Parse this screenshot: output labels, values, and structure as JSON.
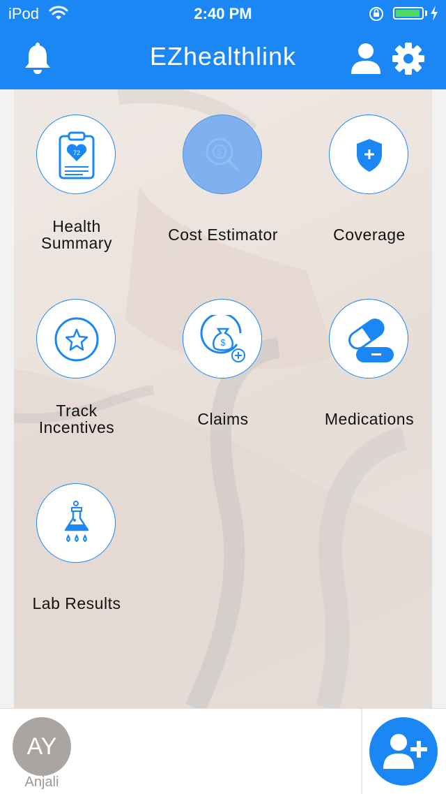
{
  "status_bar": {
    "carrier": "iPod",
    "time": "2:40 PM",
    "battery_fraction": 0.95,
    "icons": [
      "wifi-icon",
      "orientation-lock-icon",
      "battery-icon",
      "charging-bolt-icon"
    ]
  },
  "nav": {
    "title": "EZhealthlink",
    "icons": [
      "bell-icon",
      "user-icon",
      "gear-icon"
    ]
  },
  "colors": {
    "brand": "#1a87f5",
    "active_tile": "#7fb1f0",
    "avatar_bg": "#aba5a1",
    "battery": "#4cd964"
  },
  "tiles": [
    {
      "label": "Health Summary",
      "icon": "clipboard-heart-icon",
      "badge": "72"
    },
    {
      "label": "Cost Estimator",
      "icon": "cost-search-icon",
      "active": true
    },
    {
      "label": "Coverage",
      "icon": "shield-plus-icon"
    },
    {
      "label": "Track Incentives",
      "icon": "star-icon"
    },
    {
      "label": "Claims",
      "icon": "money-bag-icon"
    },
    {
      "label": "Medications",
      "icon": "pill-capsule-icon"
    },
    {
      "label": "Lab Results",
      "icon": "flask-icon"
    }
  ],
  "bottom": {
    "avatar_initials": "AY",
    "avatar_name": "Anjali",
    "add_icon": "add-user-icon"
  }
}
